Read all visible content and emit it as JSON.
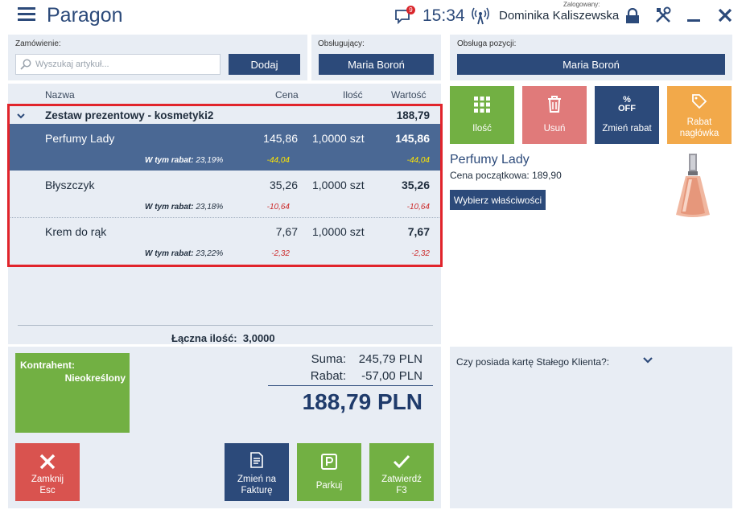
{
  "app": {
    "title": "Paragon"
  },
  "topbar": {
    "message_badge": "9",
    "clock": "15:34",
    "logged_label": "Zalogowany:",
    "user_name": "Dominika Kaliszewska"
  },
  "order": {
    "label": "Zamówienie:",
    "search_placeholder": "Wyszukaj artykuł...",
    "add_button": "Dodaj"
  },
  "served_by": {
    "label": "Obsługujący:",
    "value": "Maria Boroń"
  },
  "item_service": {
    "label": "Obsługa pozycji:",
    "value": "Maria Boroń"
  },
  "table": {
    "headers": {
      "name": "Nazwa",
      "price": "Cena",
      "qty": "Ilość",
      "value": "Wartość"
    },
    "group": {
      "name": "Zestaw prezentowy - kosmetyki2",
      "value": "188,79"
    },
    "items": [
      {
        "name": "Perfumy Lady",
        "price": "145,86",
        "qty": "1,0000 szt",
        "value": "145,86",
        "disc_label": "W tym rabat:",
        "disc_pct": "23,19%",
        "disc_price": "-44,04",
        "disc_value": "-44,04"
      },
      {
        "name": "Błyszczyk",
        "price": "35,26",
        "qty": "1,0000 szt",
        "value": "35,26",
        "disc_label": "W tym rabat:",
        "disc_pct": "23,18%",
        "disc_price": "-10,64",
        "disc_value": "-10,64"
      },
      {
        "name": "Krem do rąk",
        "price": "7,67",
        "qty": "1,0000 szt",
        "value": "7,67",
        "disc_label": "W tym rabat:",
        "disc_pct": "23,22%",
        "disc_price": "-2,32",
        "disc_value": "-2,32"
      }
    ],
    "total_qty_label": "Łączna ilość:",
    "total_qty_value": "3,0000"
  },
  "contractor": {
    "label": "Kontrahent:",
    "value": "Nieokreślony"
  },
  "totals": {
    "sum_label": "Suma:",
    "sum_value": "245,79 PLN",
    "discount_label": "Rabat:",
    "discount_value": "-57,00 PLN",
    "grand_total": "188,79 PLN"
  },
  "bottom_buttons": {
    "close_line1": "Zamknij",
    "close_line2": "Esc",
    "invoice_line1": "Zmień na",
    "invoice_line2": "Fakturę",
    "park": "Parkuj",
    "confirm_line1": "Zatwierdź",
    "confirm_line2": "F3"
  },
  "action_tiles": {
    "qty": "Ilość",
    "delete": "Usuń",
    "change_discount": "Zmień rabat",
    "off_text": "OFF",
    "header_discount_line1": "Rabat",
    "header_discount_line2": "nagłówka"
  },
  "product": {
    "name": "Perfumy Lady",
    "initial_price": "Cena początkowa: 189,90",
    "properties_button": "Wybierz właściwości"
  },
  "loyalty": {
    "question": "Czy posiada kartę Stałego Klienta?:"
  },
  "colors": {
    "navy": "#2c4a7a",
    "selected_row": "#4a6894",
    "green": "#72b043",
    "red": "#d9534f",
    "orange": "#f2a94a",
    "highlight_border": "#e1242b"
  }
}
